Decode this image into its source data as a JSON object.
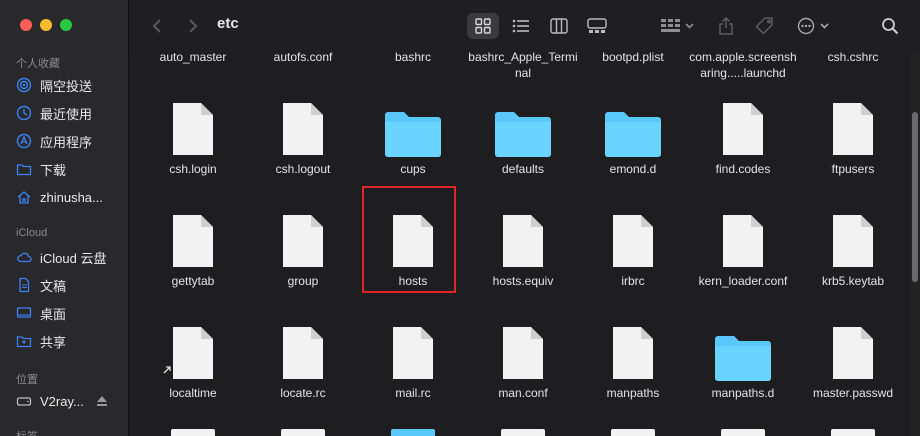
{
  "toolbar": {
    "title": "etc"
  },
  "sidebar": {
    "section_favorites": "个人收藏",
    "favorites": [
      {
        "label": "隔空投送",
        "icon": "airdrop-icon"
      },
      {
        "label": "最近使用",
        "icon": "clock-icon"
      },
      {
        "label": "应用程序",
        "icon": "applications-icon"
      },
      {
        "label": "下载",
        "icon": "folder-icon"
      },
      {
        "label": "zhinusha...",
        "icon": "home-icon"
      }
    ],
    "section_icloud": "iCloud",
    "icloud": [
      {
        "label": "iCloud 云盘",
        "icon": "cloud-icon"
      },
      {
        "label": "文稿",
        "icon": "document-icon"
      },
      {
        "label": "桌面",
        "icon": "desktop-icon"
      },
      {
        "label": "共享",
        "icon": "shared-folder-icon"
      }
    ],
    "section_locations": "位置",
    "locations": [
      {
        "label": "V2ray...",
        "icon": "disk-icon"
      }
    ],
    "section_tags": "标签"
  },
  "files": {
    "top_row": [
      "auto_master",
      "autofs.conf",
      "bashrc",
      "bashrc_Apple_Terminal",
      "bootpd.plist",
      "com.apple.screensharing.....launchd",
      "csh.cshrc"
    ],
    "rows": [
      [
        {
          "name": "csh.login",
          "kind": "file"
        },
        {
          "name": "csh.logout",
          "kind": "file"
        },
        {
          "name": "cups",
          "kind": "folder"
        },
        {
          "name": "defaults",
          "kind": "folder"
        },
        {
          "name": "emond.d",
          "kind": "folder"
        },
        {
          "name": "find.codes",
          "kind": "file"
        },
        {
          "name": "ftpusers",
          "kind": "file"
        }
      ],
      [
        {
          "name": "gettytab",
          "kind": "file"
        },
        {
          "name": "group",
          "kind": "file"
        },
        {
          "name": "hosts",
          "kind": "file"
        },
        {
          "name": "hosts.equiv",
          "kind": "file"
        },
        {
          "name": "irbrc",
          "kind": "file"
        },
        {
          "name": "kern_loader.conf",
          "kind": "file"
        },
        {
          "name": "krb5.keytab",
          "kind": "file"
        }
      ],
      [
        {
          "name": "localtime",
          "kind": "file"
        },
        {
          "name": "locate.rc",
          "kind": "file"
        },
        {
          "name": "mail.rc",
          "kind": "file"
        },
        {
          "name": "man.conf",
          "kind": "file"
        },
        {
          "name": "manpaths",
          "kind": "file"
        },
        {
          "name": "manpaths.d",
          "kind": "folder"
        },
        {
          "name": "master.passwd",
          "kind": "file"
        }
      ]
    ]
  },
  "colors": {
    "folder": "#5ac8fa",
    "highlight": "#e0262b",
    "accent": "#3b82f6"
  }
}
